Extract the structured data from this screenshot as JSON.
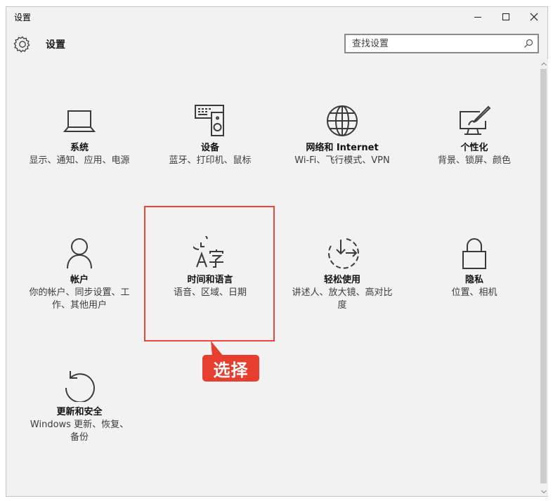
{
  "window": {
    "title": "设置",
    "controls": {
      "minimize": "minimize-icon",
      "maximize": "maximize-icon",
      "close": "close-icon"
    }
  },
  "header": {
    "icon": "gear-icon",
    "title": "设置",
    "search": {
      "placeholder": "查找设置",
      "value": "",
      "icon": "search-icon"
    }
  },
  "tiles": [
    {
      "name": "系统",
      "desc": "显示、通知、应用、电源",
      "icon": "laptop-icon"
    },
    {
      "name": "设备",
      "desc": "蓝牙、打印机、鼠标",
      "icon": "devices-icon"
    },
    {
      "name": "网络和 Internet",
      "desc": "Wi-Fi、飞行模式、VPN",
      "icon": "globe-icon"
    },
    {
      "name": "个性化",
      "desc": "背景、锁屏、颜色",
      "icon": "personalization-icon"
    },
    {
      "name": "帐户",
      "desc": "你的帐户、同步设置、工作、其他用户",
      "icon": "person-icon"
    },
    {
      "name": "时间和语言",
      "desc": "语音、区域、日期",
      "icon": "time-language-icon"
    },
    {
      "name": "轻松使用",
      "desc": "讲述人、放大镜、高对比度",
      "icon": "ease-of-access-icon"
    },
    {
      "name": "隐私",
      "desc": "位置、相机",
      "icon": "lock-icon"
    },
    {
      "name": "更新和安全",
      "desc": "Windows 更新、恢复、备份",
      "icon": "update-icon"
    }
  ],
  "annotation": {
    "label": "选择",
    "color": "#e63e2f"
  },
  "colors": {
    "window_bg": "#f2f2f2",
    "icon_stroke": "#3a3a3a",
    "highlight": "#e8473a"
  }
}
